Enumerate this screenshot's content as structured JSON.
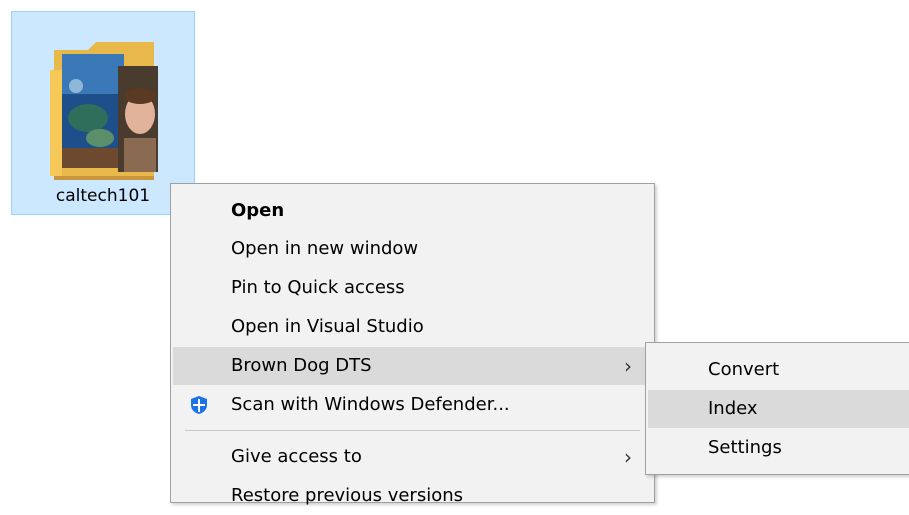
{
  "folder": {
    "name": "caltech101",
    "icon": "folder-icon"
  },
  "context_menu": {
    "items": [
      {
        "label": "Open",
        "bold": true
      },
      {
        "label": "Open in new window"
      },
      {
        "label": "Pin to Quick access"
      },
      {
        "label": "Open in Visual Studio"
      },
      {
        "label": "Brown Dog DTS",
        "has_submenu": true,
        "highlighted": true
      },
      {
        "label": "Scan with Windows Defender...",
        "icon": "windows-defender-icon"
      },
      {
        "label": "Give access to",
        "has_submenu": true
      },
      {
        "label": "Restore previous versions"
      }
    ],
    "submenu_chevron": "›"
  },
  "submenu": {
    "items": [
      {
        "label": "Convert"
      },
      {
        "label": "Index",
        "highlighted": true
      },
      {
        "label": "Settings"
      }
    ]
  },
  "colors": {
    "selection_bg": "#cce8ff",
    "menu_bg": "#f2f2f2",
    "highlight_bg": "#dadada",
    "defender_blue": "#1a73e8"
  }
}
